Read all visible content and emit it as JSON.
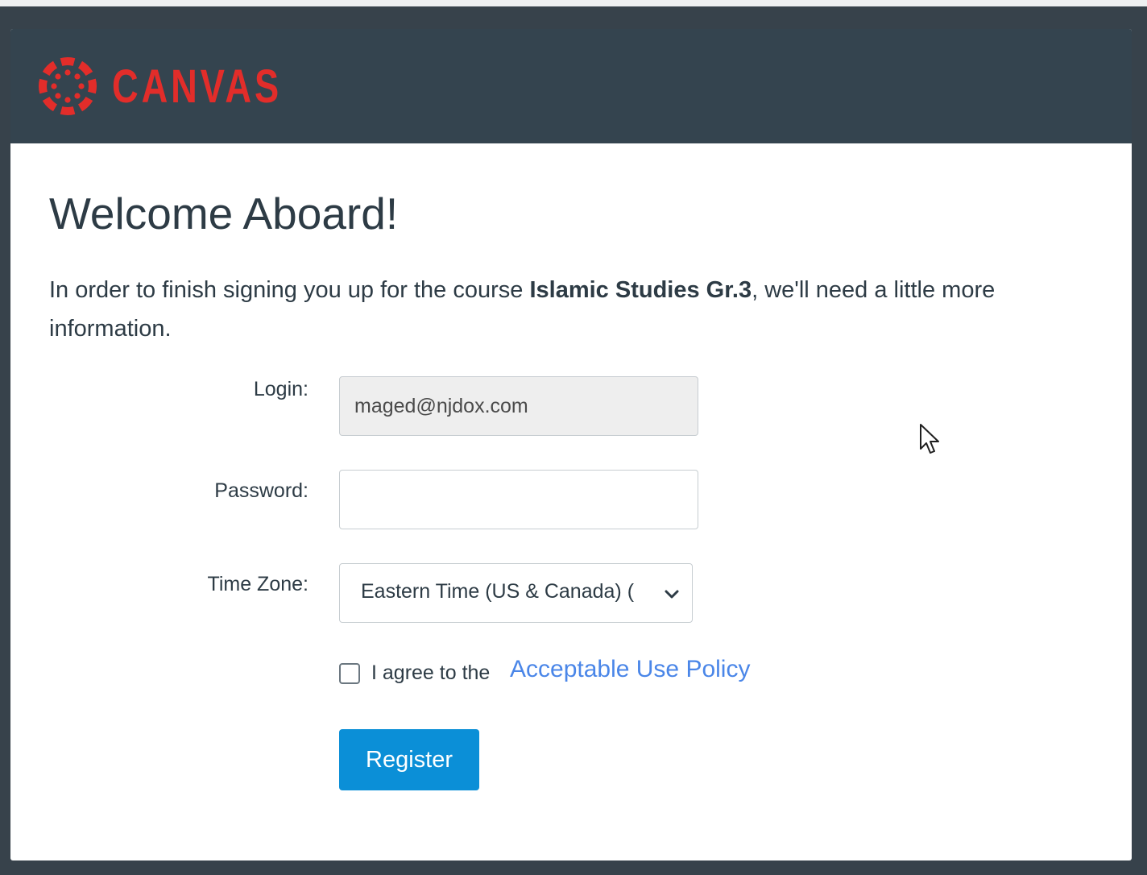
{
  "brand": {
    "name": "CANVAS",
    "color": "#e22d2a",
    "header_bg": "#34444f"
  },
  "page": {
    "title": "Welcome Aboard!",
    "intro_before": "In order to finish signing you up for the course ",
    "course_name": "Islamic Studies Gr.3",
    "intro_after": ", we'll need a little more information."
  },
  "form": {
    "login_label": "Login:",
    "login_value": "maged@njdox.com",
    "password_label": "Password:",
    "password_value": "",
    "timezone_label": "Time Zone:",
    "timezone_value": "Eastern Time (US & Canada) (",
    "agree_text": "I agree to the",
    "policy_link": "Acceptable Use Policy",
    "agree_checked": false,
    "register_label": "Register",
    "register_color": "#0b8fd7"
  },
  "icons": {
    "logo": "canvas-logo-icon",
    "dropdown": "chevron-down-icon",
    "cursor": "mouse-pointer-icon"
  }
}
